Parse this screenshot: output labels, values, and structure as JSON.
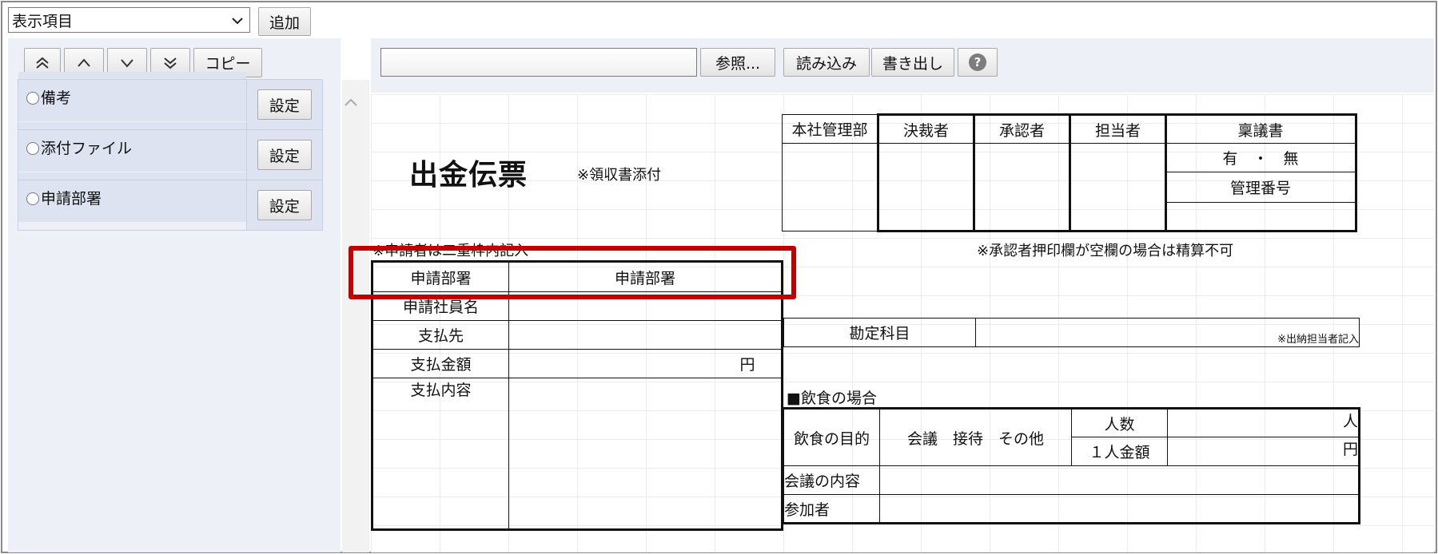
{
  "toolbar": {
    "select_value": "表示項目",
    "add_label": "追加"
  },
  "left_panel": {
    "arrow_buttons": [
      "first",
      "up",
      "down",
      "last"
    ],
    "copy_label": "コピー",
    "items": [
      {
        "label": "備考",
        "button": "設定"
      },
      {
        "label": "添付ファイル",
        "button": "設定"
      },
      {
        "label": "申請部署",
        "button": "設定"
      }
    ]
  },
  "right_toolbar": {
    "file_value": "",
    "browse_label": "参照...",
    "read_label": "読み込み",
    "write_label": "書き出し"
  },
  "form": {
    "title": "出金伝票",
    "receipt_note": "※領収書添付",
    "approval_headers": [
      "本社管理部",
      "決裁者",
      "承認者",
      "担当者"
    ],
    "proposal_header": "稟議書",
    "proposal_options": "有　・　無",
    "control_number": "管理番号",
    "applicant_note": "※申請者は二重枠内記入",
    "approval_note": "※承認者押印欄が空欄の場合は精算不可",
    "rows": {
      "dept_label": "申請部署",
      "dept_value": "申請部署",
      "employee_label": "申請社員名",
      "payee_label": "支払先",
      "amount_label": "支払金額",
      "yen": "円",
      "content_label": "支払内容"
    },
    "account_label": "勘定科目",
    "account_note": "※出納担当者記入",
    "food_heading": "■飲食の場合",
    "food_purpose_label": "飲食の目的",
    "food_purpose_options": "会議　接待　その他",
    "people_label": "人数",
    "people_unit": "人",
    "per_person_label": "１人金額",
    "per_person_unit": "円",
    "meeting_label": "会議の内容",
    "attendees_label": "参加者"
  }
}
